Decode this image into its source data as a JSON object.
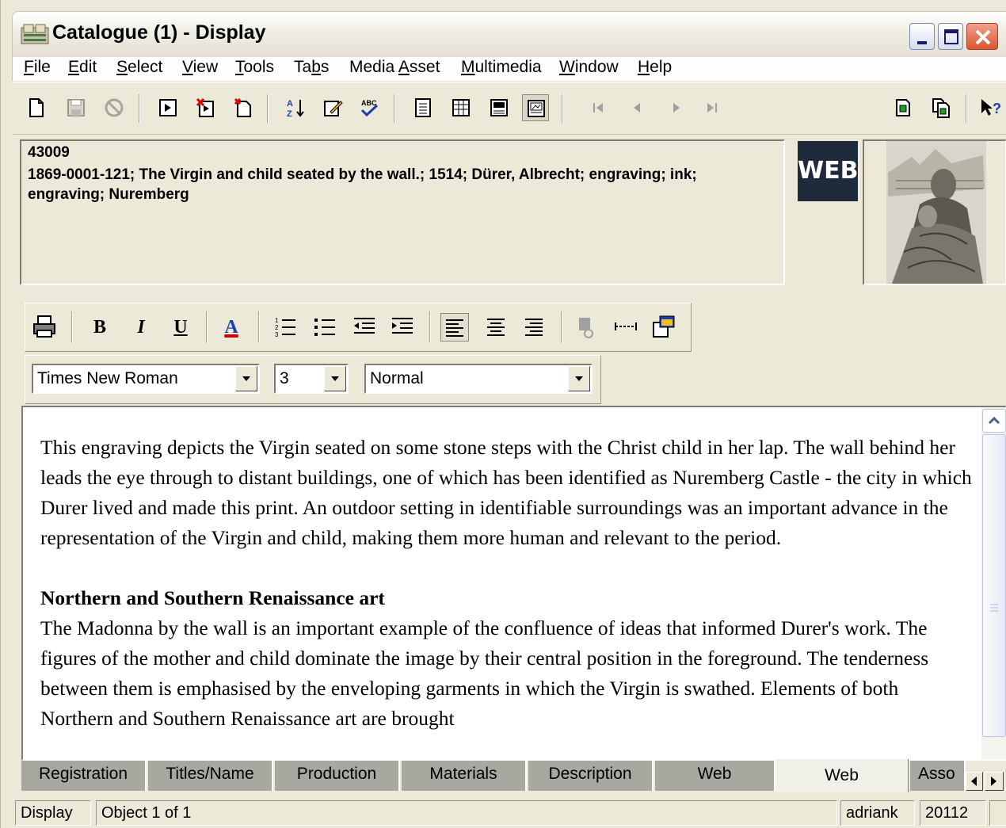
{
  "window": {
    "title": "Catalogue (1) - Display"
  },
  "menu": [
    {
      "pre": "",
      "u": "F",
      "post": "ile"
    },
    {
      "pre": "",
      "u": "E",
      "post": "dit"
    },
    {
      "pre": "",
      "u": "S",
      "post": "elect"
    },
    {
      "pre": "",
      "u": "V",
      "post": "iew"
    },
    {
      "pre": "",
      "u": "T",
      "post": "ools"
    },
    {
      "pre": "Ta",
      "u": "b",
      "post": "s"
    },
    {
      "pre": "Media ",
      "u": "A",
      "post": "sset"
    },
    {
      "pre": "",
      "u": "M",
      "post": "ultimedia"
    },
    {
      "pre": "",
      "u": "W",
      "post": "indow"
    },
    {
      "pre": "",
      "u": "H",
      "post": "elp"
    }
  ],
  "record": {
    "id": "43009",
    "summary": "1869-0001-121; The Virgin and child seated by the wall.; 1514; Dürer, Albrecht; engraving; ink; engraving; Nuremberg",
    "badge": "WEB"
  },
  "format": {
    "font": "Times New Roman",
    "size": "3",
    "style": "Normal",
    "bold": "B",
    "italic": "I",
    "underline": "U",
    "color": "A"
  },
  "editor": {
    "para1": "This engraving depicts the Virgin seated on some stone steps with the Christ child in her lap.  The wall behind her leads the eye through to distant buildings, one of which has been identified as Nuremberg Castle - the city in which Durer lived and made this print. An outdoor setting in identifiable surroundings was an important advance in the representation of the Virgin and child, making them more human and relevant to the period.",
    "heading": "Northern and Southern Renaissance art",
    "para2": "The Madonna by the wall is an important example of the confluence of ideas that informed Durer's work. The figures of the mother and child dominate the image by their central position in the foreground. The tenderness between them is emphasised by the enveloping garments in which the Virgin is swathed. Elements of both Northern and Southern Renaissance art are brought"
  },
  "tabs": [
    "Registration",
    "Titles/Name",
    "Production",
    "Materials",
    "Description",
    "Web",
    "Web",
    "Asso"
  ],
  "active_tab_index": 6,
  "status": {
    "mode": "Display",
    "position": "Object 1 of 1",
    "user": "adriank",
    "code": "20112"
  }
}
